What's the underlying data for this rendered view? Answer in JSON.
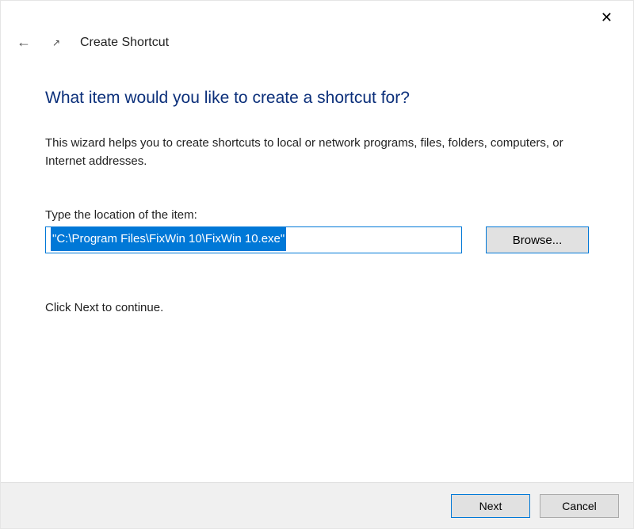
{
  "window": {
    "close_aria": "Close"
  },
  "header": {
    "breadcrumb": "Create Shortcut"
  },
  "main": {
    "heading": "What item would you like to create a shortcut for?",
    "description": "This wizard helps you to create shortcuts to local or network programs, files, folders, computers, or Internet addresses.",
    "location_label": "Type the location of the item:",
    "location_value": "\"C:\\Program Files\\FixWin 10\\FixWin 10.exe\"",
    "browse_label": "Browse...",
    "continue_hint": "Click Next to continue."
  },
  "footer": {
    "next_label": "Next",
    "cancel_label": "Cancel"
  }
}
